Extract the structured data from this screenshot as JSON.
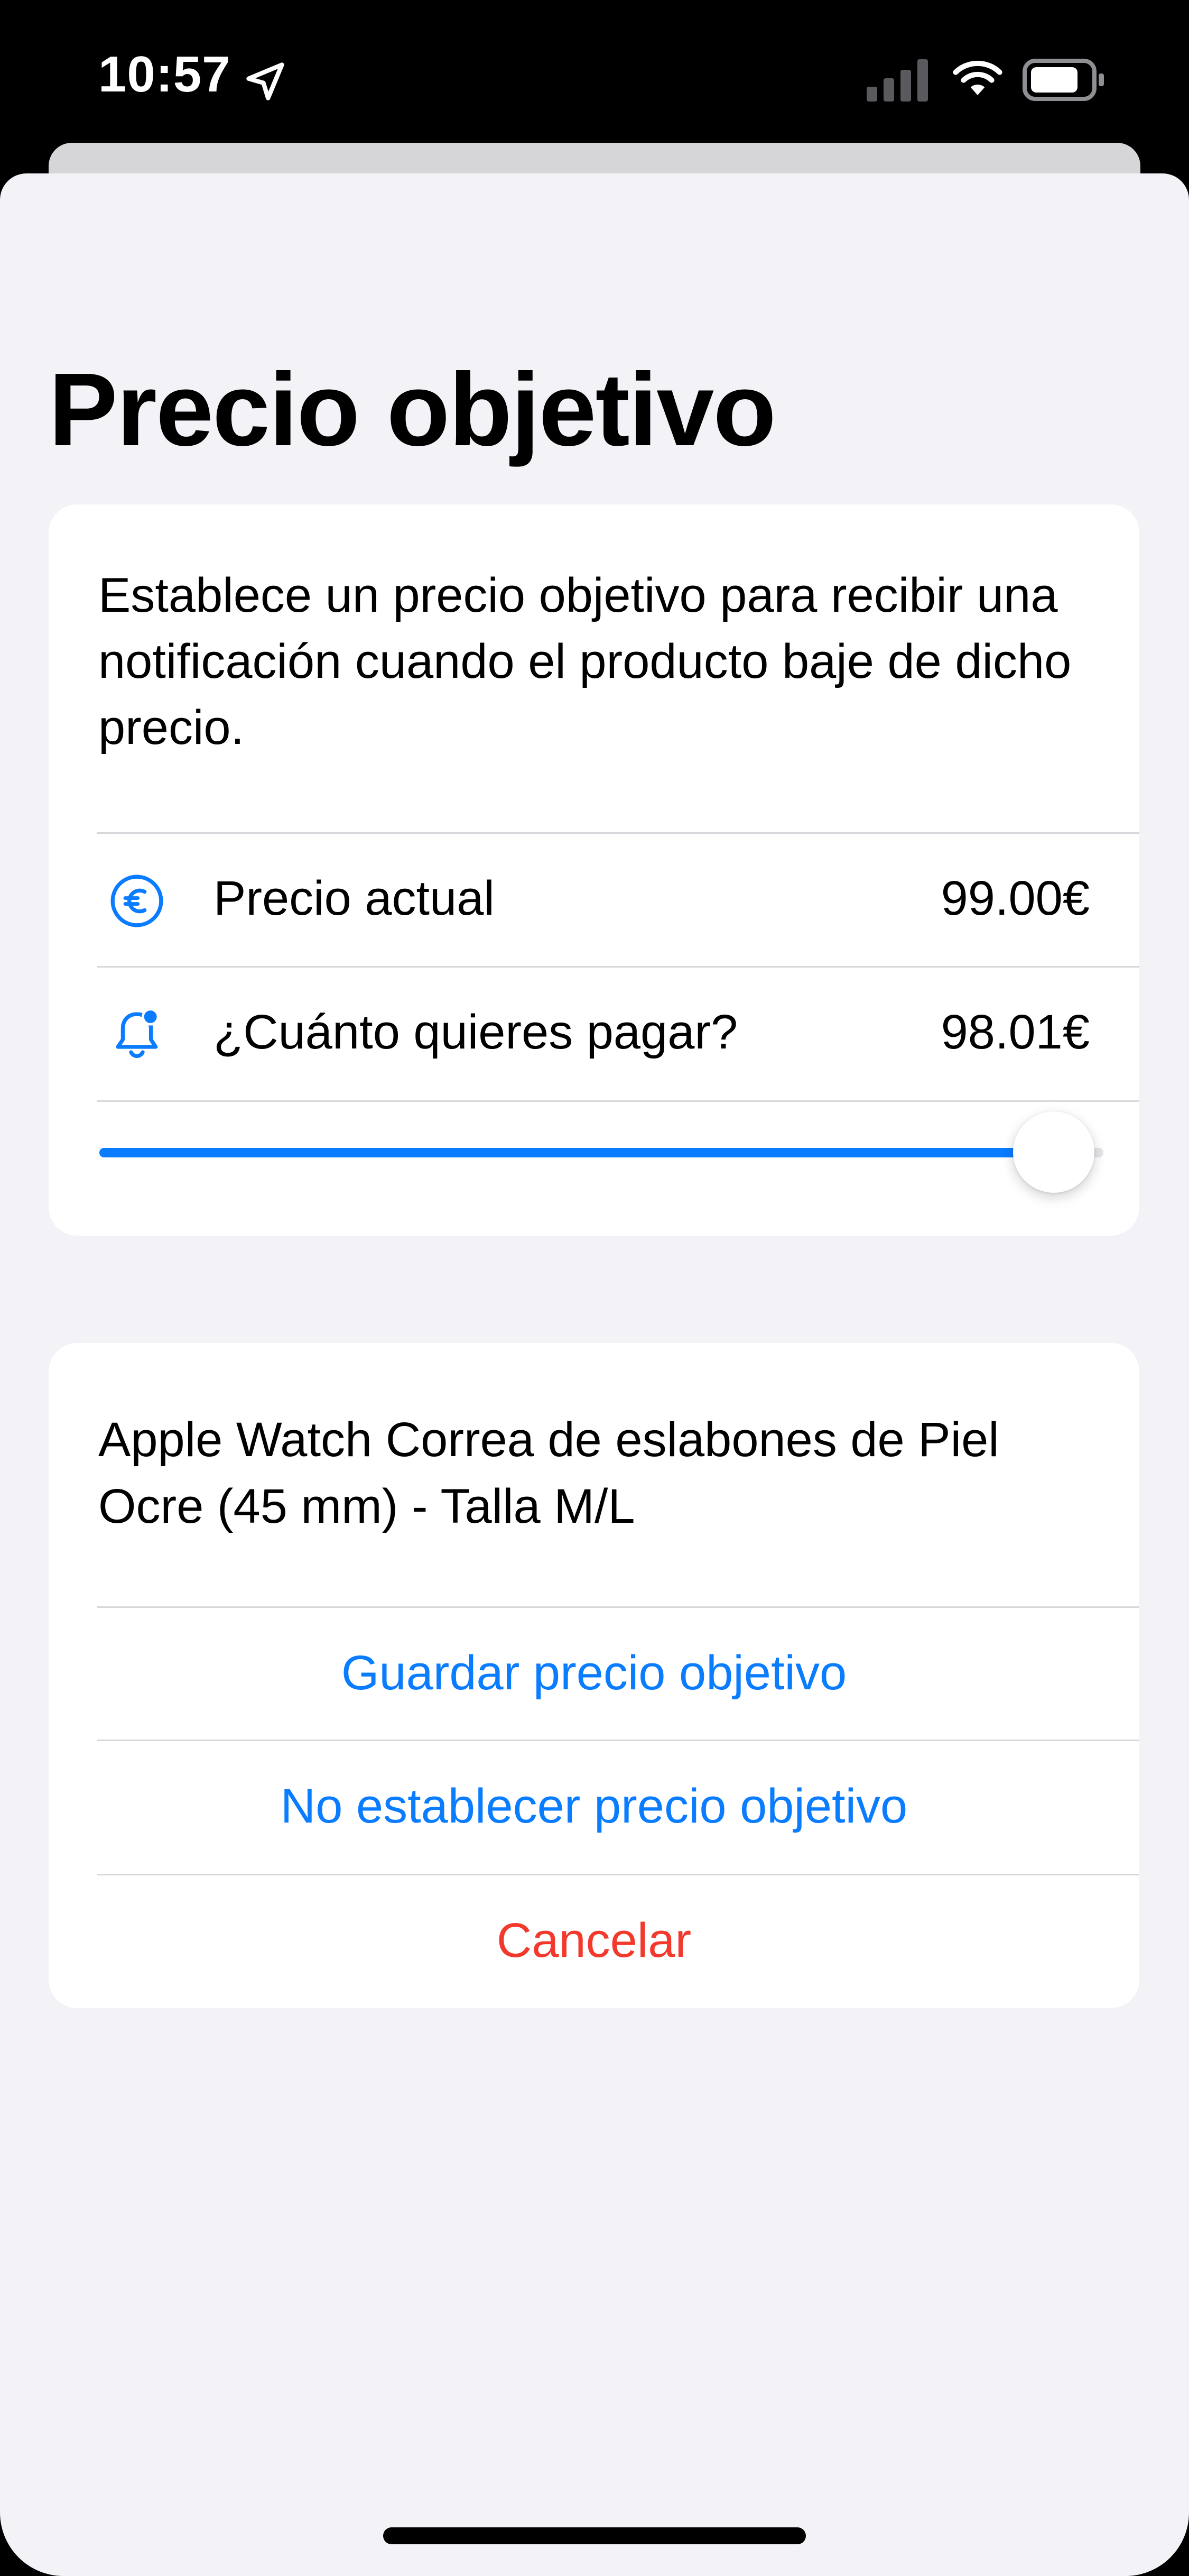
{
  "status_bar": {
    "time": "10:57",
    "icons": [
      "location-arrow-icon",
      "cellular-signal-icon",
      "wifi-icon",
      "battery-icon"
    ]
  },
  "sheet": {
    "title": "Precio objetivo",
    "description": "Establece un precio objetivo para recibir una notificación cuando el producto baje de dicho precio.",
    "rows": [
      {
        "icon": "euro-circle-icon",
        "label": "Precio actual",
        "value": "99.00€"
      },
      {
        "icon": "bell-badge-icon",
        "label": "¿Cuánto quieres pagar?",
        "value": "98.01€"
      }
    ],
    "slider": {
      "min": 0,
      "max": 99.0,
      "value": 98.01
    },
    "product": {
      "name": "Apple Watch Correa de eslabones de Piel Ocre (45 mm) - Talla M/L"
    },
    "actions": {
      "save": "Guardar precio objetivo",
      "unset": "No establecer precio objetivo",
      "cancel": "Cancelar"
    }
  },
  "colors": {
    "accent": "#0a7cff",
    "destructive": "#f2392c",
    "background": "#f2f2f7",
    "card": "#ffffff"
  }
}
